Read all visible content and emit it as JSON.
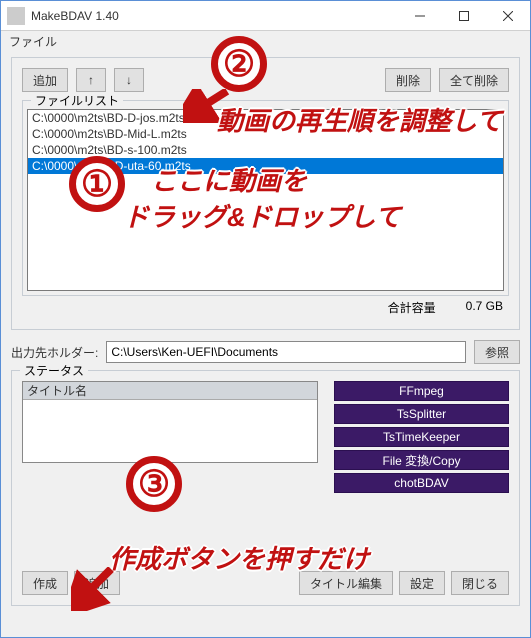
{
  "titlebar": {
    "title": "MakeBDAV 1.40"
  },
  "menubar": {
    "file": "ファイル"
  },
  "toolbar": {
    "add": "追加",
    "up": "↑",
    "down": "↓",
    "delete": "削除",
    "delete_all": "全て削除"
  },
  "filelist": {
    "legend": "ファイルリスト",
    "items": [
      "C:\\0000\\m2ts\\BD-D-jos.m2ts",
      "C:\\0000\\m2ts\\BD-Mid-L.m2ts",
      "C:\\0000\\m2ts\\BD-s-100.m2ts",
      "C:\\0000\\m2ts\\BD-uta-60.m2ts"
    ],
    "total_label": "合計容量",
    "total_value": "0.7 GB"
  },
  "output": {
    "label": "出力先ホルダー:",
    "path": "C:\\Users\\Ken-UEFI\\Documents",
    "browse": "参照"
  },
  "status": {
    "legend": "ステータス",
    "title_col": "タイトル名",
    "stages": [
      "FFmpeg",
      "TsSplitter",
      "TsTimeKeeper",
      "File 変換/Copy",
      "chotBDAV"
    ]
  },
  "bottom": {
    "create": "作成",
    "add": "追加",
    "title_edit": "タイトル編集",
    "settings": "設定",
    "close": "閉じる"
  },
  "annotations": {
    "n1": "①",
    "n2": "②",
    "n3": "③",
    "t1a": "ここに動画を",
    "t1b": "ドラッグ&ドロップして",
    "t2": "動画の再生順を調整して",
    "t3": "作成ボタンを押すだけ"
  }
}
